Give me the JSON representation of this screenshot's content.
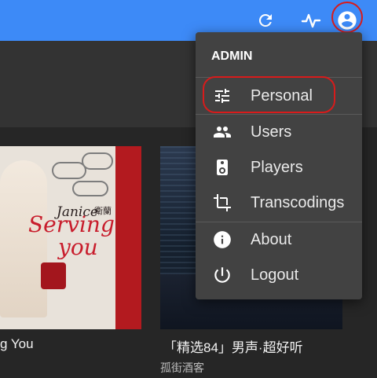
{
  "topbar": {
    "icons": [
      "refresh-icon",
      "activity-icon",
      "account-circle-icon"
    ],
    "accent_color": "#3d8af7"
  },
  "albums": [
    {
      "cover_text": {
        "artist_latin": "Janice",
        "artist_cn": "衛蘭",
        "title_line1": "Serving",
        "title_line2": "you"
      },
      "caption": "g You"
    },
    {
      "caption": "「精选84」男声·超好听",
      "subtitle": "孤街酒客"
    }
  ],
  "menu": {
    "header": "ADMIN",
    "items": [
      {
        "label": "Personal",
        "icon": "tune-sliders-icon"
      },
      {
        "label": "Users",
        "icon": "people-icon"
      },
      {
        "label": "Players",
        "icon": "speaker-icon"
      },
      {
        "label": "Transcodings",
        "icon": "crop-rotate-icon"
      },
      {
        "label": "About",
        "icon": "info-icon"
      },
      {
        "label": "Logout",
        "icon": "power-icon"
      }
    ]
  },
  "highlight_color": "#d81b1b"
}
